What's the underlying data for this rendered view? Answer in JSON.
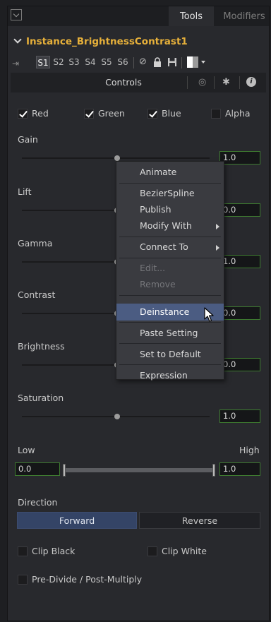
{
  "header": {
    "tabs": [
      {
        "label": "Tools",
        "active": true
      },
      {
        "label": "Modifiers",
        "active": false
      }
    ]
  },
  "tool": {
    "name": "Instance_BrightnessContrast1",
    "slots": [
      "S1",
      "S2",
      "S3",
      "S4",
      "S5",
      "S6"
    ],
    "active_slot": "S1",
    "icons": [
      "pin-icon",
      "disable-icon",
      "lock-icon",
      "save-icon",
      "color-swatch-icon",
      "dropdown-icon"
    ]
  },
  "controls_bar": {
    "label": "Controls",
    "icons": [
      "node-icon",
      "settings-icon",
      "info-icon"
    ]
  },
  "channels": [
    {
      "label": "Red",
      "checked": true
    },
    {
      "label": "Green",
      "checked": true
    },
    {
      "label": "Blue",
      "checked": true
    },
    {
      "label": "Alpha",
      "checked": false
    }
  ],
  "sliders": [
    {
      "label": "Gain",
      "value": "1.0"
    },
    {
      "label": "Lift",
      "value": "0.0"
    },
    {
      "label": "Gamma",
      "value": "1.0"
    },
    {
      "label": "Contrast",
      "value": "0.0"
    },
    {
      "label": "Brightness",
      "value": "0.0"
    },
    {
      "label": "Saturation",
      "value": "1.0"
    }
  ],
  "range": {
    "low_label": "Low",
    "high_label": "High",
    "low_value": "0.0",
    "high_value": "1.0"
  },
  "direction": {
    "label": "Direction",
    "options": [
      "Forward",
      "Reverse"
    ],
    "selected": "Forward"
  },
  "clip": [
    {
      "label": "Clip Black",
      "checked": false
    },
    {
      "label": "Clip White",
      "checked": false
    },
    {
      "label": "Pre-Divide / Post-Multiply",
      "checked": false
    }
  ],
  "context_menu": {
    "items": [
      {
        "label": "Animate",
        "state": "normal",
        "submenu": false
      },
      {
        "label": "BezierSpline",
        "state": "normal",
        "submenu": false
      },
      {
        "label": "Publish",
        "state": "normal",
        "submenu": false
      },
      {
        "label": "Modify With",
        "state": "normal",
        "submenu": true
      },
      {
        "label": "Connect To",
        "state": "normal",
        "submenu": true
      },
      {
        "label": "Edit...",
        "state": "disabled",
        "submenu": false
      },
      {
        "label": "Remove",
        "state": "disabled",
        "submenu": false
      },
      {
        "label": "Deinstance",
        "state": "highlighted",
        "submenu": false
      },
      {
        "label": "Paste Setting",
        "state": "normal",
        "submenu": false
      },
      {
        "label": "Set to Default",
        "state": "normal",
        "submenu": false
      },
      {
        "label": "Expression",
        "state": "normal",
        "submenu": false
      }
    ]
  },
  "colors": {
    "accent_title": "#e6b03a",
    "field_border": "#3e7a30",
    "menu_highlight": "#4b5c82",
    "button_selected": "#344466"
  }
}
